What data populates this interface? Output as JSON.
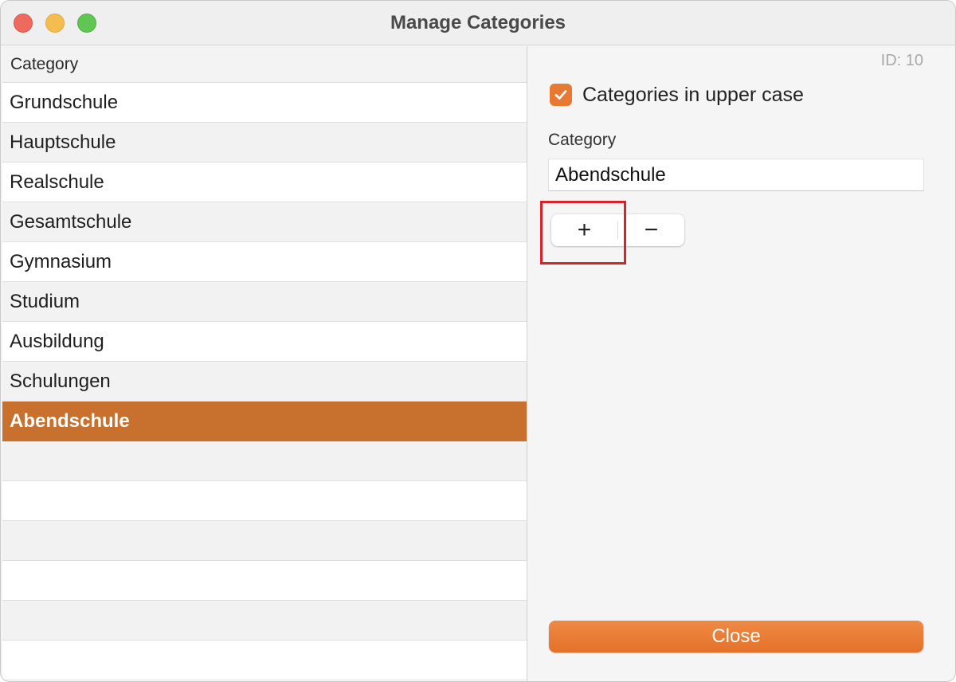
{
  "window": {
    "title": "Manage Categories"
  },
  "table": {
    "header": "Category",
    "rows": [
      "Grundschule",
      "Hauptschule",
      "Realschule",
      "Gesamtschule",
      "Gymnasium",
      "Studium",
      "Ausbildung",
      "Schulungen",
      "Abendschule"
    ],
    "selected_index": 8,
    "empty_rows": 6
  },
  "detail": {
    "id_label": "ID: 10",
    "uppercase_checkbox": {
      "label": "Categories in upper case",
      "checked": true
    },
    "category_field": {
      "label": "Category",
      "value": "Abendschule"
    },
    "add_label": "+",
    "remove_label": "−",
    "close_label": "Close"
  },
  "colors": {
    "accent": "#e77a32",
    "selection": "#c8712f",
    "highlight_box": "#d8232a"
  },
  "icons": {
    "checkbox": "checkmark-icon"
  }
}
